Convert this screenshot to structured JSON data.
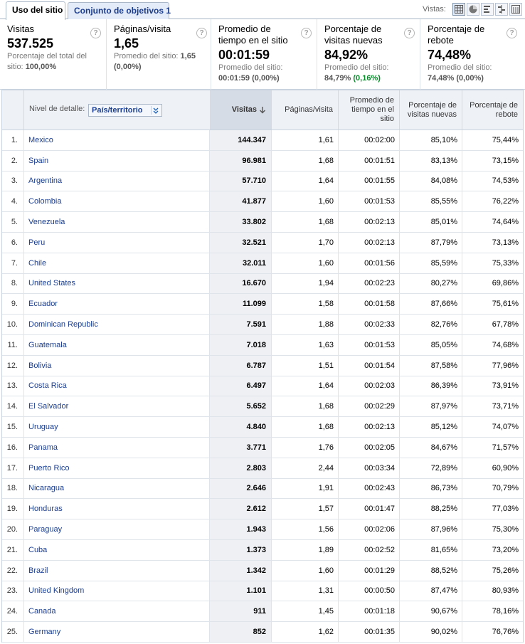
{
  "tabs": [
    {
      "label": "Uso del sitio"
    },
    {
      "label": "Conjunto de objetivos 1"
    }
  ],
  "views": {
    "label": "Vistas:"
  },
  "summary": {
    "visits": {
      "title": "Visitas",
      "value": "537.525",
      "sub_prefix": "Porcentaje del total del sitio: ",
      "sub_value": "100,00%"
    },
    "pages": {
      "title": "Páginas/visita",
      "value": "1,65",
      "sub_prefix": "Promedio del sitio: ",
      "sub_value": "1,65",
      "sub_change": "(0,00%)"
    },
    "time": {
      "title": "Promedio de tiempo en el sitio",
      "value": "00:01:59",
      "sub_prefix": "Promedio del sitio: ",
      "sub_value": "00:01:59",
      "sub_change": "(0,00%)"
    },
    "new_visits": {
      "title": "Porcentaje de visitas nuevas",
      "value": "84,92%",
      "sub_prefix": "Promedio del sitio: ",
      "sub_value": "84,79%",
      "sub_change": "(0,16%)"
    },
    "bounce": {
      "title": "Porcentaje de rebote",
      "value": "74,48%",
      "sub_prefix": "Promedio del sitio: ",
      "sub_value": "74,48%",
      "sub_change": "(0,00%)"
    }
  },
  "table": {
    "detail_label": "Nivel de detalle:",
    "detail_select": "País/territorio",
    "headers": {
      "visits": "Visitas",
      "pages": "Páginas/visita",
      "time": "Promedio de tiempo en el sitio",
      "new": "Porcentaje de visitas nuevas",
      "bounce": "Porcentaje de rebote"
    },
    "rows": [
      {
        "idx": "1.",
        "country": "Mexico",
        "visits": "144.347",
        "pages": "1,61",
        "time": "00:02:00",
        "new": "85,10%",
        "bounce": "75,44%"
      },
      {
        "idx": "2.",
        "country": "Spain",
        "visits": "96.981",
        "pages": "1,68",
        "time": "00:01:51",
        "new": "83,13%",
        "bounce": "73,15%"
      },
      {
        "idx": "3.",
        "country": "Argentina",
        "visits": "57.710",
        "pages": "1,64",
        "time": "00:01:55",
        "new": "84,08%",
        "bounce": "74,53%"
      },
      {
        "idx": "4.",
        "country": "Colombia",
        "visits": "41.877",
        "pages": "1,60",
        "time": "00:01:53",
        "new": "85,55%",
        "bounce": "76,22%"
      },
      {
        "idx": "5.",
        "country": "Venezuela",
        "visits": "33.802",
        "pages": "1,68",
        "time": "00:02:13",
        "new": "85,01%",
        "bounce": "74,64%"
      },
      {
        "idx": "6.",
        "country": "Peru",
        "visits": "32.521",
        "pages": "1,70",
        "time": "00:02:13",
        "new": "87,79%",
        "bounce": "73,13%"
      },
      {
        "idx": "7.",
        "country": "Chile",
        "visits": "32.011",
        "pages": "1,60",
        "time": "00:01:56",
        "new": "85,59%",
        "bounce": "75,33%"
      },
      {
        "idx": "8.",
        "country": "United States",
        "visits": "16.670",
        "pages": "1,94",
        "time": "00:02:23",
        "new": "80,27%",
        "bounce": "69,86%"
      },
      {
        "idx": "9.",
        "country": "Ecuador",
        "visits": "11.099",
        "pages": "1,58",
        "time": "00:01:58",
        "new": "87,66%",
        "bounce": "75,61%"
      },
      {
        "idx": "10.",
        "country": "Dominican Republic",
        "visits": "7.591",
        "pages": "1,88",
        "time": "00:02:33",
        "new": "82,76%",
        "bounce": "67,78%"
      },
      {
        "idx": "11.",
        "country": "Guatemala",
        "visits": "7.018",
        "pages": "1,63",
        "time": "00:01:53",
        "new": "85,05%",
        "bounce": "74,68%"
      },
      {
        "idx": "12.",
        "country": "Bolivia",
        "visits": "6.787",
        "pages": "1,51",
        "time": "00:01:54",
        "new": "87,58%",
        "bounce": "77,96%"
      },
      {
        "idx": "13.",
        "country": "Costa Rica",
        "visits": "6.497",
        "pages": "1,64",
        "time": "00:02:03",
        "new": "86,39%",
        "bounce": "73,91%"
      },
      {
        "idx": "14.",
        "country": "El Salvador",
        "visits": "5.652",
        "pages": "1,68",
        "time": "00:02:29",
        "new": "87,97%",
        "bounce": "73,71%"
      },
      {
        "idx": "15.",
        "country": "Uruguay",
        "visits": "4.840",
        "pages": "1,68",
        "time": "00:02:13",
        "new": "85,12%",
        "bounce": "74,07%"
      },
      {
        "idx": "16.",
        "country": "Panama",
        "visits": "3.771",
        "pages": "1,76",
        "time": "00:02:05",
        "new": "84,67%",
        "bounce": "71,57%"
      },
      {
        "idx": "17.",
        "country": "Puerto Rico",
        "visits": "2.803",
        "pages": "2,44",
        "time": "00:03:34",
        "new": "72,89%",
        "bounce": "60,90%"
      },
      {
        "idx": "18.",
        "country": "Nicaragua",
        "visits": "2.646",
        "pages": "1,91",
        "time": "00:02:43",
        "new": "86,73%",
        "bounce": "70,79%"
      },
      {
        "idx": "19.",
        "country": "Honduras",
        "visits": "2.612",
        "pages": "1,57",
        "time": "00:01:47",
        "new": "88,25%",
        "bounce": "77,03%"
      },
      {
        "idx": "20.",
        "country": "Paraguay",
        "visits": "1.943",
        "pages": "1,56",
        "time": "00:02:06",
        "new": "87,96%",
        "bounce": "75,30%"
      },
      {
        "idx": "21.",
        "country": "Cuba",
        "visits": "1.373",
        "pages": "1,89",
        "time": "00:02:52",
        "new": "81,65%",
        "bounce": "73,20%"
      },
      {
        "idx": "22.",
        "country": "Brazil",
        "visits": "1.342",
        "pages": "1,60",
        "time": "00:01:29",
        "new": "88,52%",
        "bounce": "75,26%"
      },
      {
        "idx": "23.",
        "country": "United Kingdom",
        "visits": "1.101",
        "pages": "1,31",
        "time": "00:00:50",
        "new": "87,47%",
        "bounce": "80,93%"
      },
      {
        "idx": "24.",
        "country": "Canada",
        "visits": "911",
        "pages": "1,45",
        "time": "00:01:18",
        "new": "90,67%",
        "bounce": "78,16%"
      },
      {
        "idx": "25.",
        "country": "Germany",
        "visits": "852",
        "pages": "1,62",
        "time": "00:01:35",
        "new": "90,02%",
        "bounce": "76,76%"
      }
    ]
  }
}
